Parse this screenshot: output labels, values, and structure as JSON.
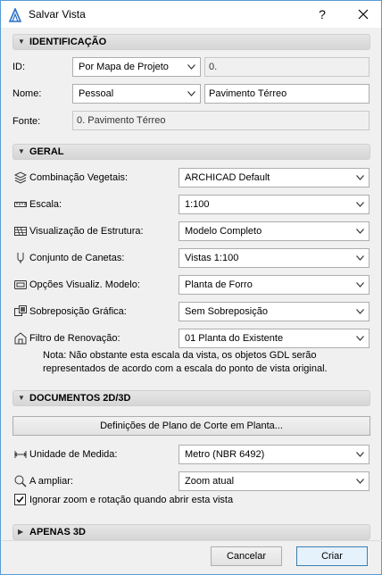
{
  "window": {
    "title": "Salvar Vista",
    "help_label": "?",
    "accent_color": "#5a9bd5"
  },
  "identificacao": {
    "header": "IDENTIFICAÇÃO",
    "id_label": "ID:",
    "id_combo_value": "Por Mapa de Projeto",
    "id_field_value": "0.",
    "nome_label": "Nome:",
    "nome_combo_value": "Pessoal",
    "nome_field_value": "Pavimento Térreo",
    "fonte_label": "Fonte:",
    "fonte_value": "0. Pavimento Térreo"
  },
  "geral": {
    "header": "GERAL",
    "rows": [
      {
        "label": "Combinação Vegetais:",
        "value": "ARCHICAD Default",
        "icon": "layer-combination-icon"
      },
      {
        "label": "Escala:",
        "value": "1:100",
        "icon": "scale-ruler-icon"
      },
      {
        "label": "Visualização de Estrutura:",
        "value": "Modelo Completo",
        "icon": "structure-display-icon"
      },
      {
        "label": "Conjunto de Canetas:",
        "value": "Vistas 1:100",
        "icon": "pen-set-icon"
      },
      {
        "label": "Opções Visualiz. Modelo:",
        "value": "Planta de Forro",
        "icon": "model-view-options-icon"
      },
      {
        "label": "Sobreposição Gráfica:",
        "value": "Sem Sobreposição",
        "icon": "graphic-override-icon"
      },
      {
        "label": "Filtro de Renovação:",
        "value": "01 Planta do Existente",
        "icon": "renovation-filter-icon"
      }
    ],
    "note_line1": "Nota: Não obstante esta escala da vista, os objetos GDL serão",
    "note_line2": "representados de acordo com a escala do ponto de vista original."
  },
  "documentos": {
    "header": "DOCUMENTOS 2D/3D",
    "cut_plane_button": "Definições de Plano de Corte em Planta...",
    "unidade_label": "Unidade de Medida:",
    "unidade_value": "Metro (NBR 6492)",
    "ampliar_label": "A ampliar:",
    "ampliar_value": "Zoom atual",
    "ignore_zoom_label": "Ignorar zoom e rotação quando abrir esta vista",
    "ignore_zoom_checked": true
  },
  "apenas3d": {
    "header": "APENAS 3D"
  },
  "footer": {
    "cancel_label": "Cancelar",
    "create_label": "Criar"
  }
}
